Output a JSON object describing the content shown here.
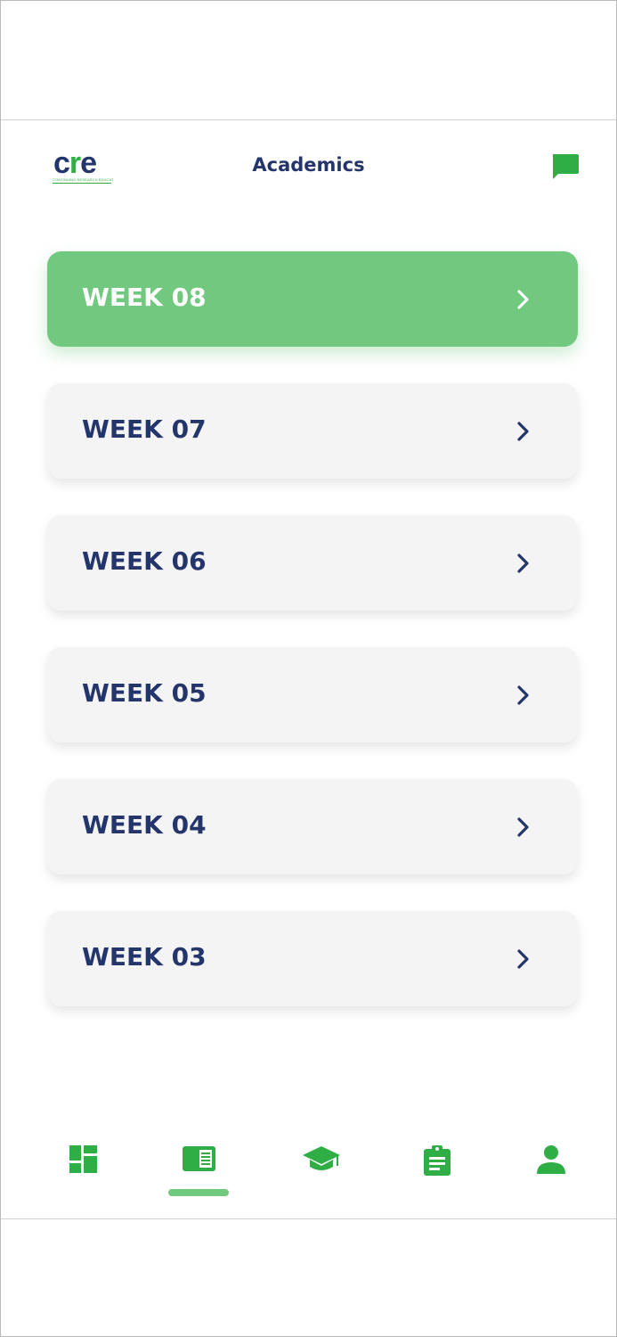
{
  "header": {
    "logo_text_c": "c",
    "logo_text_r": "r",
    "logo_text_e": "e",
    "logo_tagline": "CONTINUING RESEARCH EDUCATION",
    "title": "Academics",
    "chat_icon": "chat-bubble-icon"
  },
  "weeks": [
    {
      "label": "WEEK 08",
      "active": true
    },
    {
      "label": "WEEK 07",
      "active": false
    },
    {
      "label": "WEEK 06",
      "active": false
    },
    {
      "label": "WEEK 05",
      "active": false
    },
    {
      "label": "WEEK 04",
      "active": false
    },
    {
      "label": "WEEK 03",
      "active": false
    }
  ],
  "bottom_nav": {
    "items": [
      {
        "icon": "dashboard-icon",
        "active": false
      },
      {
        "icon": "book-icon",
        "active": true
      },
      {
        "icon": "graduation-cap-icon",
        "active": false
      },
      {
        "icon": "clipboard-icon",
        "active": false
      },
      {
        "icon": "profile-icon",
        "active": false
      }
    ]
  },
  "colors": {
    "brand_green": "#2fae46",
    "active_green": "#70c97e",
    "navy": "#23356b",
    "card_bg": "#f4f4f5"
  }
}
